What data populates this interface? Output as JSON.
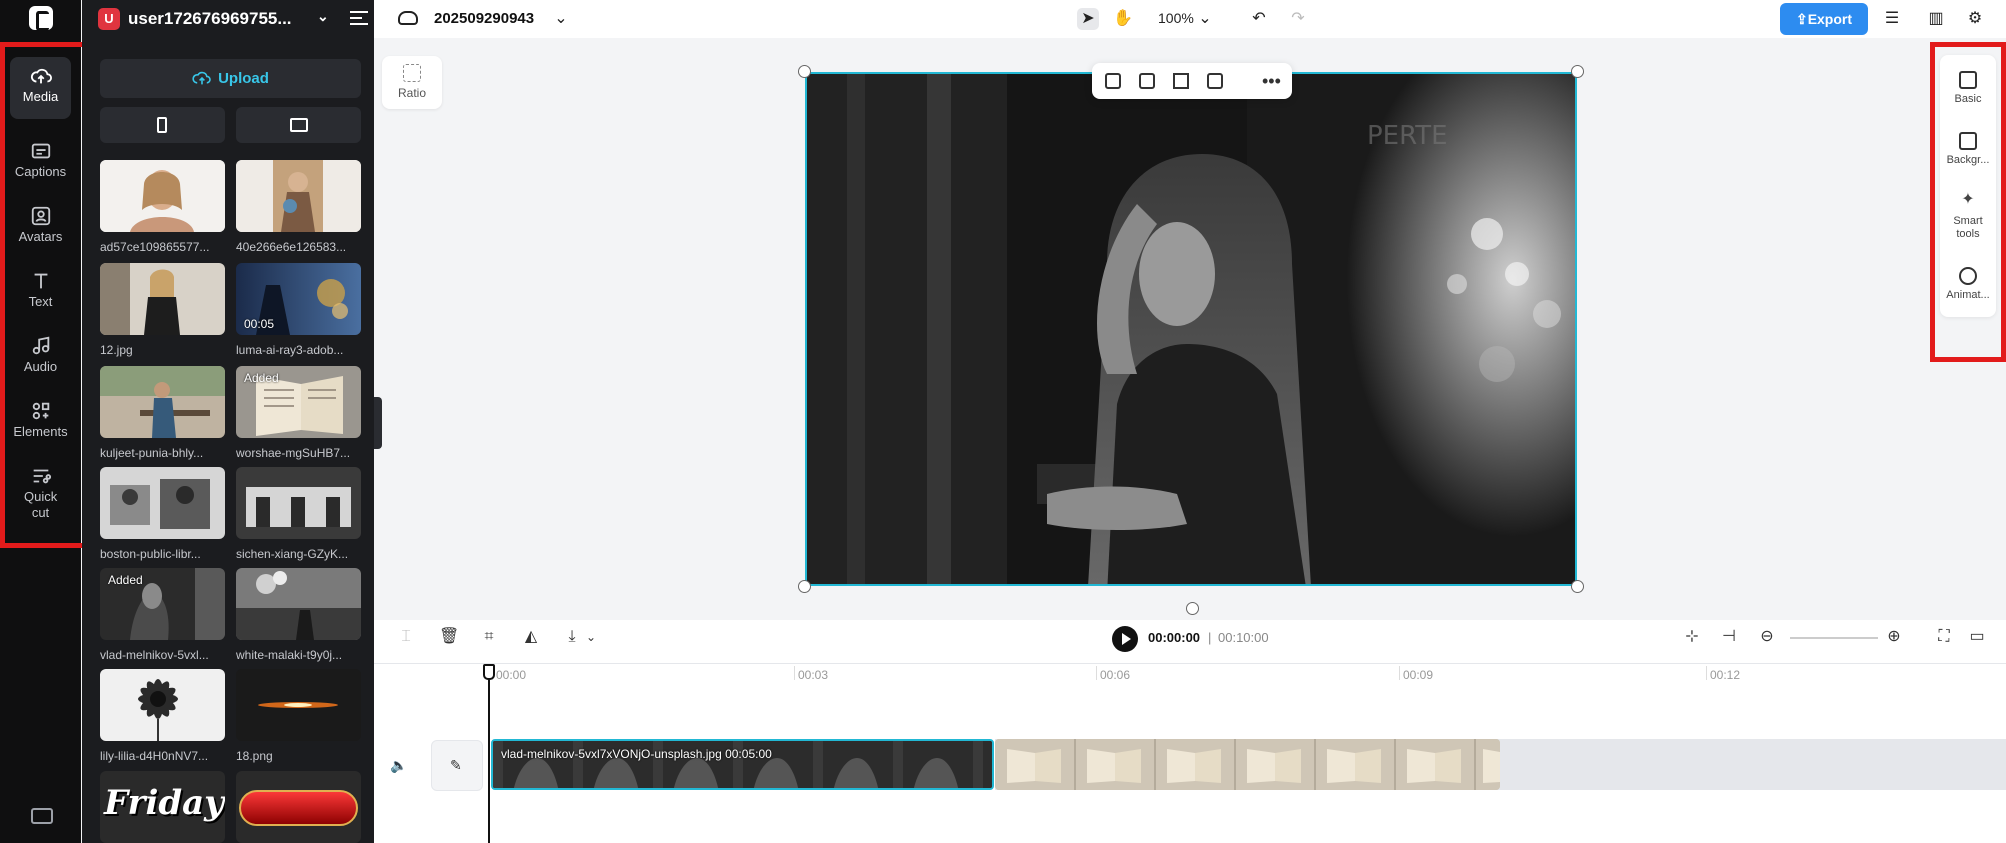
{
  "nav": {
    "items": [
      {
        "label": "Media",
        "icon": "cloud-upload-icon",
        "active": true
      },
      {
        "label": "Captions",
        "icon": "captions-icon"
      },
      {
        "label": "Avatars",
        "icon": "avatar-icon"
      },
      {
        "label": "Text",
        "icon": "text-icon"
      },
      {
        "label": "Audio",
        "icon": "music-note-icon"
      },
      {
        "label": "Elements",
        "icon": "elements-icon"
      },
      {
        "label": "Quick cut",
        "icon": "quick-cut-icon"
      }
    ]
  },
  "media_panel": {
    "user": "user172676969755...",
    "user_initial": "U",
    "upload_label": "Upload",
    "items": [
      {
        "name": "ad57ce109865577...",
        "tag": "",
        "duration": ""
      },
      {
        "name": "40e266e6e126583...",
        "tag": "",
        "duration": ""
      },
      {
        "name": "12.jpg",
        "tag": "",
        "duration": ""
      },
      {
        "name": "luma-ai-ray3-adob...",
        "tag": "",
        "duration": "00:05"
      },
      {
        "name": "kuljeet-punia-bhly...",
        "tag": "",
        "duration": ""
      },
      {
        "name": "worshae-mgSuHB7...",
        "tag": "Added",
        "duration": ""
      },
      {
        "name": "boston-public-libr...",
        "tag": "",
        "duration": ""
      },
      {
        "name": "sichen-xiang-GZyK...",
        "tag": "",
        "duration": ""
      },
      {
        "name": "vlad-melnikov-5vxl...",
        "tag": "Added",
        "duration": ""
      },
      {
        "name": "white-malaki-t9y0j...",
        "tag": "",
        "duration": ""
      },
      {
        "name": "lily-lilia-d4H0nNV7...",
        "tag": "",
        "duration": ""
      },
      {
        "name": "18.png",
        "tag": "",
        "duration": ""
      },
      {
        "name": "",
        "tag": "",
        "duration": "",
        "text": "Friday"
      },
      {
        "name": "",
        "tag": "",
        "duration": ""
      }
    ]
  },
  "topbar": {
    "project_name": "202509290943",
    "zoom": "100%",
    "export_label": "Export"
  },
  "canvas": {
    "ratio_label": "Ratio"
  },
  "props": {
    "items": [
      {
        "label": "Basic"
      },
      {
        "label": "Backgr..."
      },
      {
        "label": "Smart tools"
      },
      {
        "label": "Animat..."
      }
    ]
  },
  "playback": {
    "current": "00:00:00",
    "total": "00:10:00"
  },
  "timeline": {
    "ticks": [
      "00:00",
      "00:03",
      "00:06",
      "00:09",
      "00:12"
    ],
    "clip1_label": "vlad-melnikov-5vxl7xVONjO-unsplash.jpg   00:05:00"
  }
}
